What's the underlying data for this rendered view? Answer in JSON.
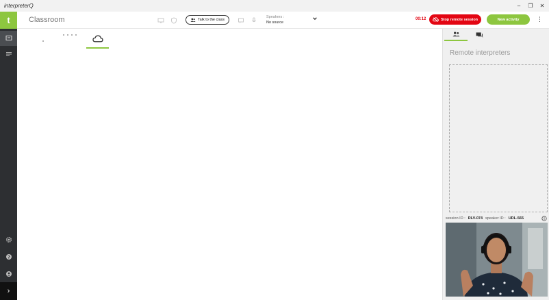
{
  "window": {
    "title": "interpreterQ",
    "controls": {
      "minimize": "–",
      "restore": "❐",
      "close": "✕"
    }
  },
  "sidebar": {
    "logo": "t",
    "items": [
      {
        "name": "classroom",
        "icon": "monitor-icon",
        "active": true
      },
      {
        "name": "menu",
        "icon": "list-icon",
        "active": false
      }
    ],
    "bottom_items": [
      {
        "name": "settings",
        "icon": "gear-icon"
      },
      {
        "name": "help",
        "icon": "help-icon"
      },
      {
        "name": "profile",
        "icon": "user-icon"
      }
    ],
    "expand": "›"
  },
  "header": {
    "title": "Classroom",
    "talk_button": "Talk to the class",
    "speakers": {
      "label": "Speakers :",
      "value": "No source"
    },
    "timer": "00:12",
    "stop_button": "Stop remote session",
    "new_activity_button": "New activity",
    "more": "⋮"
  },
  "right_panel": {
    "tabs": [
      {
        "name": "participants",
        "icon": "people-icon",
        "active": true
      },
      {
        "name": "chat",
        "icon": "chat-icon",
        "active": false
      }
    ],
    "title": "Remote interpreters",
    "session": {
      "session_label": "session ID :",
      "session_id": "RLV-074",
      "speaker_label": "speaker ID :",
      "speaker_id": "UDL-565"
    }
  },
  "colors": {
    "accent": "#8dc63f",
    "danger": "#e30613",
    "sidebar": "#2d2f32"
  }
}
